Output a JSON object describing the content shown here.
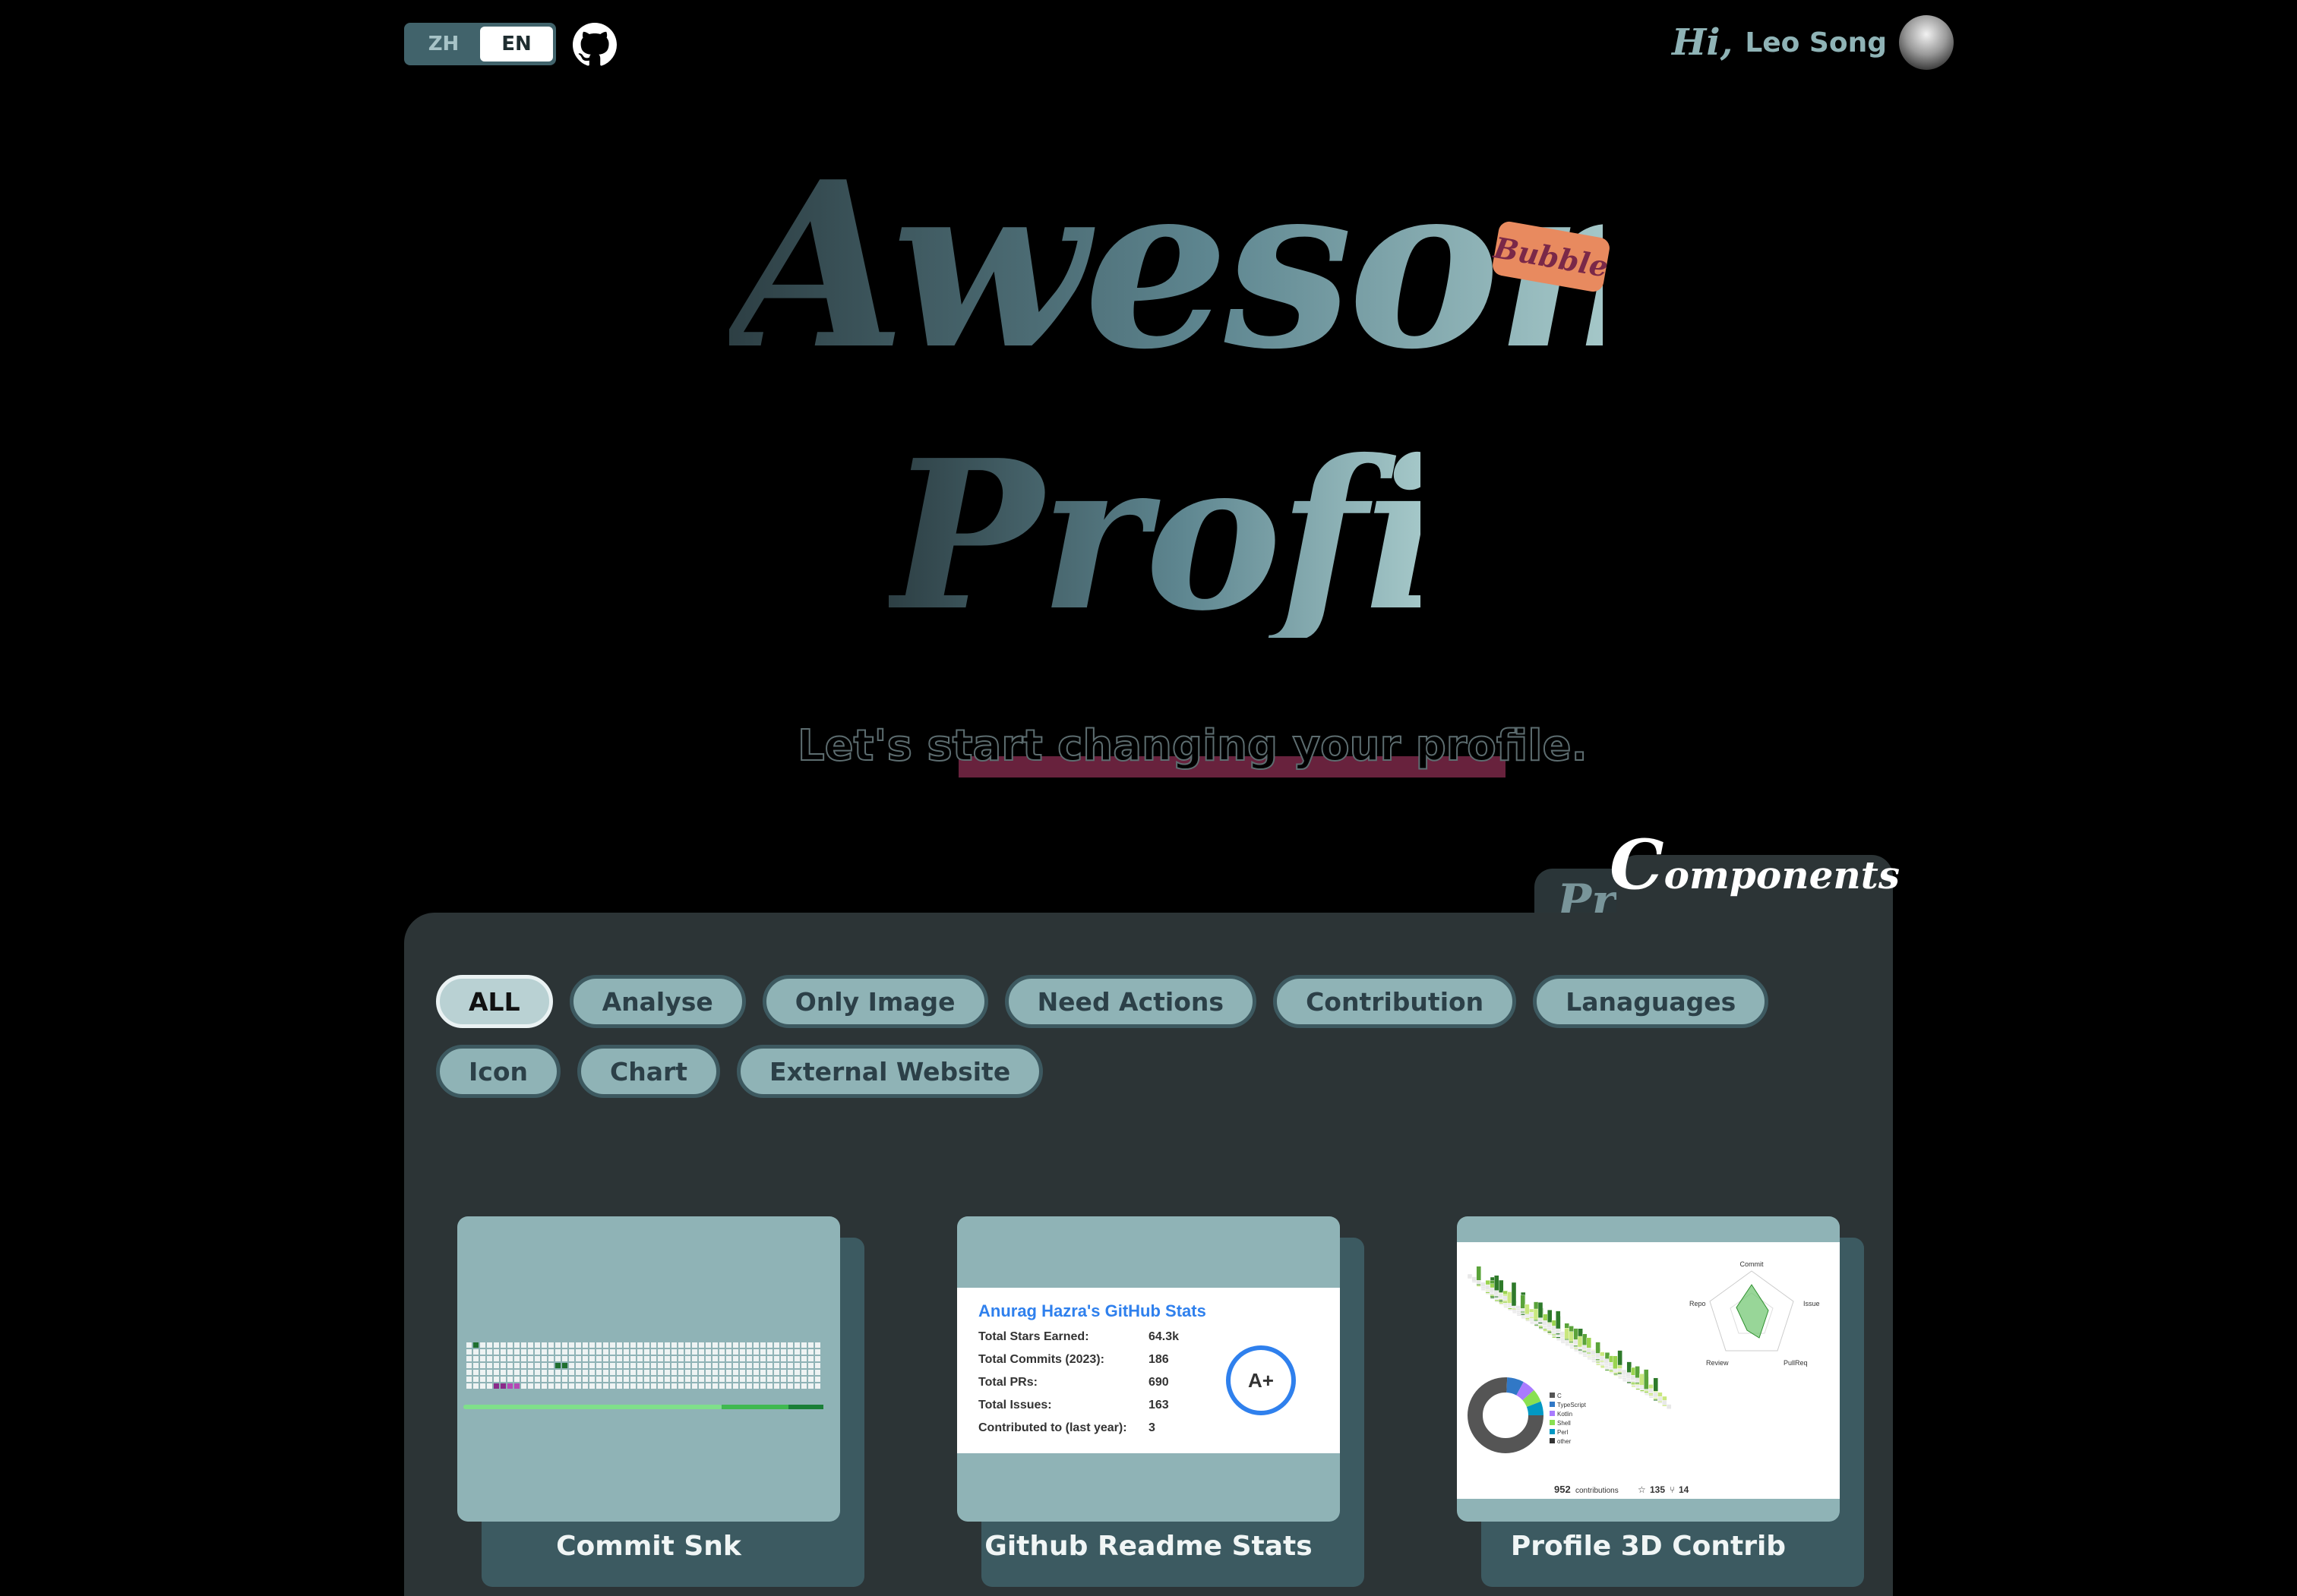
{
  "topbar": {
    "lang_options": [
      "ZH",
      "EN"
    ],
    "active_lang": "EN",
    "greeting_hi": "Hi,",
    "user_name": "Leo Song",
    "github_icon": "github-icon"
  },
  "hero": {
    "title_line1": "Awesome",
    "title_line2": "Profile",
    "badge": "Bubble",
    "subtitle": "Let's start changing your profile."
  },
  "tabs": {
    "back_label": "Pro",
    "front_label_initial": "C",
    "front_label_rest": "omponents"
  },
  "filters": [
    "ALL",
    "Analyse",
    "Only Image",
    "Need Actions",
    "Contribution",
    "Lanaguages",
    "Icon",
    "Chart",
    "External Website"
  ],
  "active_filter": "ALL",
  "cards": [
    {
      "title": "Commit Snk"
    },
    {
      "title": "Github Readme Stats",
      "stats": {
        "heading": "Anurag Hazra's GitHub Stats",
        "rows": [
          {
            "label": "Total Stars Earned:",
            "value": "64.3k"
          },
          {
            "label": "Total Commits (2023):",
            "value": "186"
          },
          {
            "label": "Total PRs:",
            "value": "690"
          },
          {
            "label": "Total Issues:",
            "value": "163"
          },
          {
            "label": "Contributed to (last year):",
            "value": "3"
          }
        ],
        "grade": "A+"
      }
    },
    {
      "title": "Profile 3D Contrib",
      "preview": {
        "radar_axes": [
          "Commit",
          "Issue",
          "PullReq",
          "Review",
          "Repo"
        ],
        "languages": [
          "C",
          "TypeScript",
          "Kotlin",
          "Shell",
          "Perl",
          "other"
        ],
        "contributions": "952",
        "contributions_label": "contributions",
        "stars": "135",
        "forks": "14"
      }
    }
  ],
  "colors": {
    "accent": "#8fb3b6",
    "panel": "#2c3436",
    "badge": "#e88a5f",
    "highlight": "#7a2848"
  }
}
